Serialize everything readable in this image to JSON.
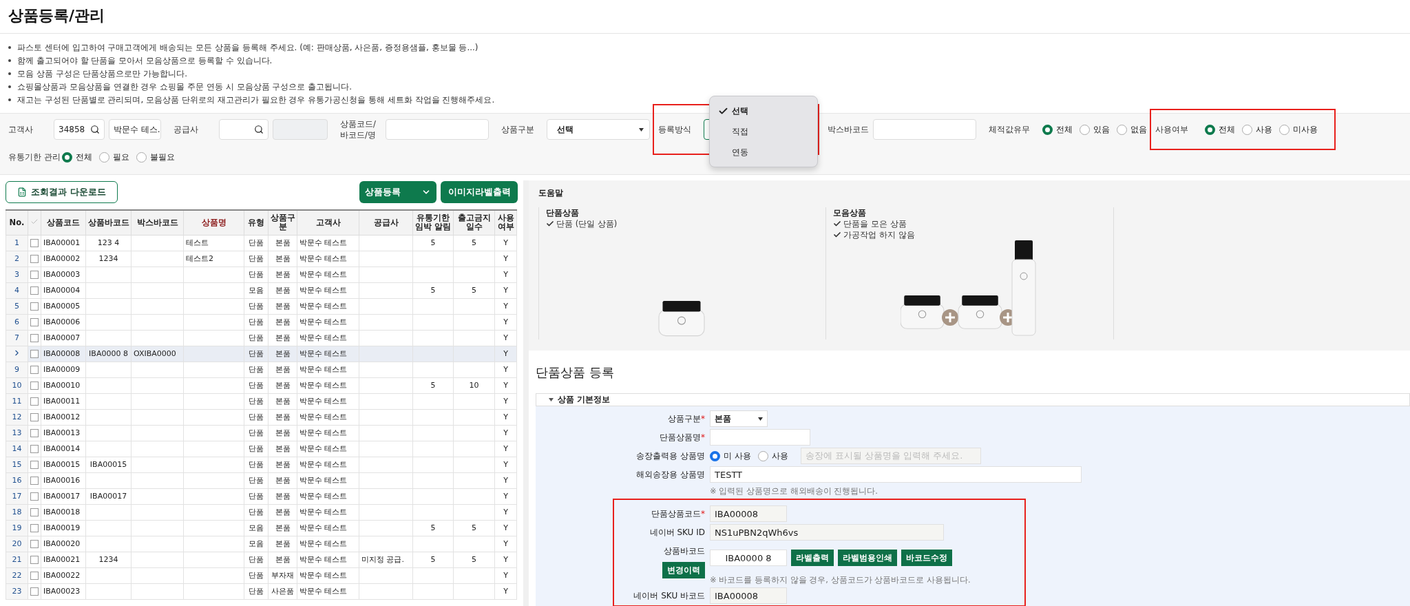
{
  "page_title": "상품등록/관리",
  "notes": [
    "파스토 센터에 입고하여 구매고객에게 배송되는 모든 상품을 등록해 주세요. (예: 판매상품, 사은품, 증정용샘플, 홍보물 등...)",
    "함께 출고되어야 할 단품을 모아서 모음상품으로 등록할 수 있습니다.",
    "모음 상품 구성은 단품상품으로만 가능합니다.",
    "쇼핑몰상품과 모음상품을 연결한 경우 쇼핑몰 주문 연동 시 모음상품 구성으로 출고됩니다.",
    "재고는 구성된 단품별로 관리되며, 모음상품 단위로의 재고관리가 필요한 경우 유통가공신청을 통해 세트화 작업을 진행해주세요."
  ],
  "filter_rows": [
    [
      {
        "kind": "customer",
        "label": "고객사",
        "code": "34858",
        "name": "박문수 테스."
      },
      {
        "kind": "supplier",
        "label": "공급사"
      },
      {
        "kind": "text",
        "label_lines": [
          "상품코드/",
          "바코드/명"
        ]
      },
      {
        "kind": "select",
        "label": "상품구분",
        "value": "선택"
      },
      {
        "kind": "dropdown",
        "label": "등록방식",
        "highlighted": true,
        "options": [
          {
            "label": "선택",
            "selected": true
          },
          {
            "label": "직접",
            "selected": false
          },
          {
            "label": "연동",
            "selected": false
          }
        ]
      },
      {
        "kind": "text",
        "label": "박스바코드"
      },
      {
        "kind": "radio",
        "label": "체적값유무",
        "highlighted": false,
        "options": [
          {
            "label": "전체",
            "selected": true
          },
          {
            "label": "있음",
            "selected": false
          },
          {
            "label": "없음",
            "selected": false
          }
        ]
      },
      {
        "kind": "radio",
        "label": "사용여부",
        "highlighted": true,
        "options": [
          {
            "label": "전체",
            "selected": true
          },
          {
            "label": "사용",
            "selected": false
          },
          {
            "label": "미사용",
            "selected": false
          }
        ]
      }
    ],
    [
      {
        "kind": "radio",
        "label": "유통기한 관리",
        "highlighted": false,
        "options": [
          {
            "label": "전체",
            "selected": true
          },
          {
            "label": "필요",
            "selected": false
          },
          {
            "label": "불필요",
            "selected": false
          }
        ]
      }
    ]
  ],
  "toolbar": {
    "download": "조회결과 다운로드",
    "register": "상품등록",
    "label_print": "이미지라벨출력"
  },
  "table": {
    "columns": [
      {
        "label": "No."
      },
      {
        "kind": "check"
      },
      {
        "label": "상품코드"
      },
      {
        "label": "상품바코드"
      },
      {
        "label": "박스바코드"
      },
      {
        "label": "상품명",
        "emphasis": true
      },
      {
        "label": "유형"
      },
      {
        "label": "상품구분"
      },
      {
        "label": "고객사"
      },
      {
        "label": "공급사"
      },
      {
        "label": "유통기한 임박 알림"
      },
      {
        "label": "출고금지일수"
      },
      {
        "label": "사용여부"
      }
    ],
    "rows": [
      {
        "no": "1",
        "checked": false,
        "selected": false,
        "code": "IBA00001",
        "barcode": "123 4",
        "name": "테스트",
        "type": "단품",
        "category": "본품",
        "customer": "박문수 테스트",
        "expiry_alert": "5",
        "hold_days": "5",
        "in_use": "Y"
      },
      {
        "no": "2",
        "checked": false,
        "selected": false,
        "code": "IBA00002",
        "barcode": "1234",
        "name": "테스트2",
        "type": "단품",
        "category": "본품",
        "customer": "박문수 테스트",
        "in_use": "Y"
      },
      {
        "no": "3",
        "checked": false,
        "selected": false,
        "code": "IBA00003",
        "type": "단품",
        "category": "본품",
        "customer": "박문수 테스트",
        "in_use": "Y"
      },
      {
        "no": "4",
        "checked": false,
        "selected": false,
        "code": "IBA00004",
        "type": "모음",
        "category": "본품",
        "customer": "박문수 테스트",
        "expiry_alert": "5",
        "hold_days": "5",
        "in_use": "Y"
      },
      {
        "no": "5",
        "checked": false,
        "selected": false,
        "code": "IBA00005",
        "type": "단품",
        "category": "본품",
        "customer": "박문수 테스트",
        "in_use": "Y"
      },
      {
        "no": "6",
        "checked": false,
        "selected": false,
        "code": "IBA00006",
        "type": "단품",
        "category": "본품",
        "customer": "박문수 테스트",
        "in_use": "Y"
      },
      {
        "no": "7",
        "checked": false,
        "selected": false,
        "code": "IBA00007",
        "type": "단품",
        "category": "본품",
        "customer": "박문수 테스트",
        "in_use": "Y"
      },
      {
        "checked": false,
        "selected": true,
        "code": "IBA00008",
        "barcode": "IBA0000   8",
        "box_barcode": "OXIBA0000",
        "type": "단품",
        "category": "본품",
        "customer": "박문수 테스트",
        "in_use": "Y"
      },
      {
        "no": "9",
        "checked": false,
        "selected": false,
        "code": "IBA00009",
        "type": "단품",
        "category": "본품",
        "customer": "박문수 테스트",
        "in_use": "Y"
      },
      {
        "no": "10",
        "checked": false,
        "selected": false,
        "code": "IBA00010",
        "type": "단품",
        "category": "본품",
        "customer": "박문수 테스트",
        "expiry_alert": "5",
        "hold_days": "10",
        "in_use": "Y"
      },
      {
        "no": "11",
        "checked": false,
        "selected": false,
        "code": "IBA00011",
        "type": "단품",
        "category": "본품",
        "customer": "박문수 테스트",
        "in_use": "Y"
      },
      {
        "no": "12",
        "checked": false,
        "selected": false,
        "code": "IBA00012",
        "type": "단품",
        "category": "본품",
        "customer": "박문수 테스트",
        "in_use": "Y"
      },
      {
        "no": "13",
        "checked": false,
        "selected": false,
        "code": "IBA00013",
        "type": "단품",
        "category": "본품",
        "customer": "박문수 테스트",
        "in_use": "Y"
      },
      {
        "no": "14",
        "checked": false,
        "selected": false,
        "code": "IBA00014",
        "type": "단품",
        "category": "본품",
        "customer": "박문수 테스트",
        "in_use": "Y"
      },
      {
        "no": "15",
        "checked": false,
        "selected": false,
        "code": "IBA00015",
        "barcode": "IBA00015",
        "type": "단품",
        "category": "본품",
        "customer": "박문수 테스트",
        "in_use": "Y"
      },
      {
        "no": "16",
        "checked": false,
        "selected": false,
        "code": "IBA00016",
        "type": "단품",
        "category": "본품",
        "customer": "박문수 테스트",
        "in_use": "Y"
      },
      {
        "no": "17",
        "checked": false,
        "selected": false,
        "code": "IBA00017",
        "barcode": "IBA00017",
        "type": "단품",
        "category": "본품",
        "customer": "박문수 테스트",
        "in_use": "Y"
      },
      {
        "no": "18",
        "checked": false,
        "selected": false,
        "code": "IBA00018",
        "type": "단품",
        "category": "본품",
        "customer": "박문수 테스트",
        "in_use": "Y"
      },
      {
        "no": "19",
        "checked": false,
        "selected": false,
        "code": "IBA00019",
        "type": "모음",
        "category": "본품",
        "customer": "박문수 테스트",
        "expiry_alert": "5",
        "hold_days": "5",
        "in_use": "Y"
      },
      {
        "no": "20",
        "checked": false,
        "selected": false,
        "code": "IBA00020",
        "type": "모음",
        "category": "본품",
        "customer": "박문수 테스트",
        "in_use": "Y"
      },
      {
        "no": "21",
        "checked": false,
        "selected": false,
        "code": "IBA00021",
        "barcode": "1234",
        "type": "단품",
        "category": "본품",
        "customer": "박문수 테스트",
        "supplier": "미지정 공급.",
        "expiry_alert": "5",
        "hold_days": "5",
        "in_use": "Y"
      },
      {
        "no": "22",
        "checked": false,
        "selected": false,
        "code": "IBA00022",
        "type": "단품",
        "category": "부자재",
        "customer": "박문수 테스트",
        "in_use": "Y"
      },
      {
        "no": "23",
        "checked": false,
        "selected": false,
        "code": "IBA00023",
        "type": "단품",
        "category": "사은품",
        "customer": "박문수 테스트",
        "in_use": "Y"
      }
    ]
  },
  "help": {
    "title": "도움말",
    "columns": [
      {
        "title": "단품상품",
        "points": [
          "단품 (단일 상품)"
        ],
        "kind": "single"
      },
      {
        "title": "모음상품",
        "points": [
          "단품을 모은 상품",
          "가공작업 하지 않음"
        ],
        "kind": "bundle"
      },
      {
        "kind": "empty"
      }
    ]
  },
  "form": {
    "title": "단품상품 등록",
    "section": {
      "title": "상품 기본정보",
      "expanded": true
    },
    "groups": [
      {
        "highlighted": false,
        "fields": [
          {
            "kind": "select",
            "label": "상품구분",
            "mark": "*",
            "value": "본품"
          },
          {
            "kind": "text",
            "label": "단품상품명",
            "mark": "*"
          },
          {
            "kind": "radio_text",
            "label": "송장출력용 상품명",
            "options": [
              {
                "label": "미 사용",
                "selected": true
              },
              {
                "label": "사용",
                "selected": false
              }
            ],
            "placeholder": "송장에 표시될 상품명을 입력해 주세요."
          },
          {
            "kind": "text",
            "label": "해외송장용 상품명",
            "value": "TESTT",
            "hint": "※ 입력된 상품명으로 해외배송이 진행됩니다."
          }
        ]
      },
      {
        "highlighted": true,
        "fields": [
          {
            "kind": "readonly",
            "label": "단품상품코드",
            "mark": "*",
            "value": "IBA00008"
          },
          {
            "kind": "readonly_wide",
            "label": "네이버 SKU ID",
            "value": "NS1uPBN2qWh6vs"
          },
          {
            "kind": "barcode",
            "label": "상품바코드",
            "history": "변경이력",
            "value": "IBA0000   8",
            "buttons": [
              "라벨출력",
              "라벨범용인쇄",
              "바코드수정"
            ],
            "hint": "※ 바코드를 등록하지 않을 경우, 상품코드가 상품바코드로 사용됩니다."
          },
          {
            "kind": "readonly",
            "label": "네이버 SKU 바코드",
            "value": "IBA00008"
          }
        ]
      }
    ]
  }
}
